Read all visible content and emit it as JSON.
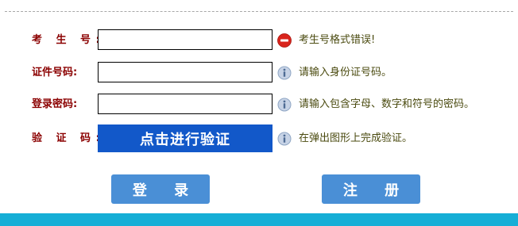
{
  "form": {
    "rows": [
      {
        "label": "考 生 号:",
        "value": "",
        "hint": "考生号格式错误!",
        "hint_icon": "error-icon"
      },
      {
        "label": "证件号码:",
        "value": "",
        "hint": "请输入身份证号码。",
        "hint_icon": "info-icon"
      },
      {
        "label": "登录密码:",
        "value": "",
        "hint": "请输入包含字母、数字和符号的密码。",
        "hint_icon": "info-icon"
      },
      {
        "label": "验 证 码:",
        "button_label": "点击进行验证",
        "hint": "在弹出图形上完成验证。",
        "hint_icon": "info-icon"
      }
    ]
  },
  "actions": {
    "login_label": "登 录",
    "register_label": "注 册"
  },
  "colors": {
    "label": "#8b0000",
    "hint_text": "#4b4b10",
    "verify_button": "#1258c9",
    "action_button": "#4a8fd6",
    "bottom_bar": "#16aed6",
    "error_icon": "#d9241c",
    "info_icon": "#8fa6c4"
  }
}
